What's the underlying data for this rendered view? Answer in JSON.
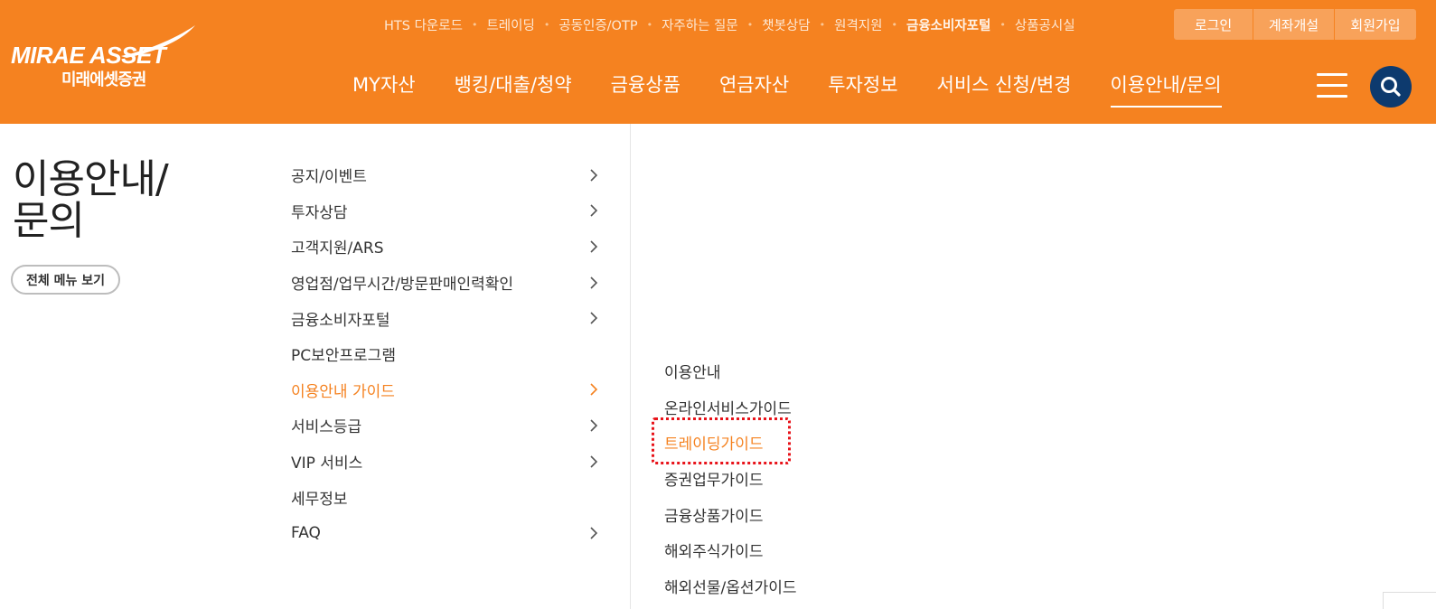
{
  "logo": {
    "en": "MIRAE ASSET",
    "ko": "미래에셋증권"
  },
  "util_links": [
    {
      "label": "HTS 다운로드",
      "bold": false
    },
    {
      "label": "트레이딩",
      "bold": false
    },
    {
      "label": "공동인증/OTP",
      "bold": false
    },
    {
      "label": "자주하는 질문",
      "bold": false
    },
    {
      "label": "챗봇상담",
      "bold": false
    },
    {
      "label": "원격지원",
      "bold": false
    },
    {
      "label": "금융소비자포털",
      "bold": true
    },
    {
      "label": "상품공시실",
      "bold": false
    }
  ],
  "auth": {
    "login": "로그인",
    "open_account": "계좌개설",
    "signup": "회원가입"
  },
  "gnb": [
    {
      "label": "MY자산",
      "active": false
    },
    {
      "label": "뱅킹/대출/청약",
      "active": false
    },
    {
      "label": "금융상품",
      "active": false
    },
    {
      "label": "연금자산",
      "active": false
    },
    {
      "label": "투자정보",
      "active": false
    },
    {
      "label": "서비스 신청/변경",
      "active": false
    },
    {
      "label": "이용안내/문의",
      "active": true
    }
  ],
  "icons": {
    "menu": "hamburger-icon",
    "search": "search-icon",
    "chevron": "chevron-right-icon"
  },
  "colors": {
    "brand": "#f58220",
    "search_bg": "#0d3a6e",
    "highlight": "#e8131a"
  },
  "page_title": "이용안내/\n문의",
  "all_menu_label": "전체 메뉴 보기",
  "mid_menu": [
    {
      "label": "공지/이벤트",
      "chevron": true,
      "active": false
    },
    {
      "label": "투자상담",
      "chevron": true,
      "active": false
    },
    {
      "label": "고객지원/ARS",
      "chevron": true,
      "active": false
    },
    {
      "label": "영업점/업무시간/방문판매인력확인",
      "chevron": true,
      "active": false
    },
    {
      "label": "금융소비자포털",
      "chevron": true,
      "active": false
    },
    {
      "label": "PC보안프로그램",
      "chevron": false,
      "active": false
    },
    {
      "label": "이용안내 가이드",
      "chevron": true,
      "active": true
    },
    {
      "label": "서비스등급",
      "chevron": true,
      "active": false
    },
    {
      "label": "VIP 서비스",
      "chevron": true,
      "active": false
    },
    {
      "label": "세무정보",
      "chevron": false,
      "active": false
    },
    {
      "label": "FAQ",
      "chevron": true,
      "active": false
    }
  ],
  "sub_menu": [
    {
      "label": "이용안내",
      "active": false
    },
    {
      "label": "온라인서비스가이드",
      "active": false
    },
    {
      "label": "트레이딩가이드",
      "active": true
    },
    {
      "label": "증권업무가이드",
      "active": false
    },
    {
      "label": "금융상품가이드",
      "active": false
    },
    {
      "label": "해외주식가이드",
      "active": false
    },
    {
      "label": "해외선물/옵션가이드",
      "active": false
    }
  ]
}
